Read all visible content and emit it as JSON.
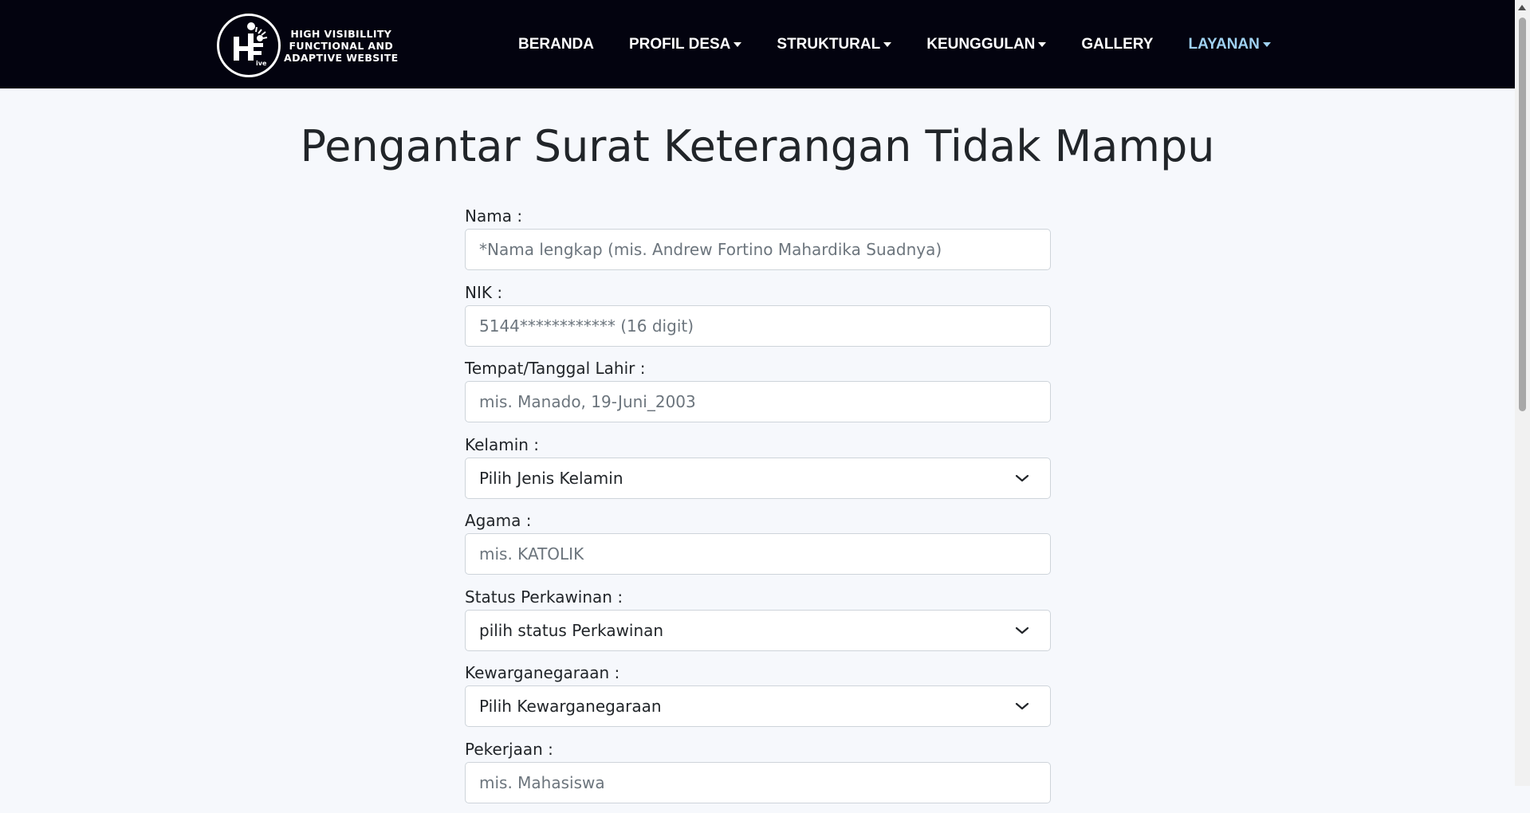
{
  "brand": {
    "logo_lines": [
      "HIGH VISIBILLITY",
      "FUNCTIONAL AND",
      "ADAPTIVE WEBSITE"
    ],
    "logo_mark": "H i F ive"
  },
  "nav": {
    "items": [
      {
        "label": "BERANDA",
        "has_dropdown": false,
        "active": false
      },
      {
        "label": "PROFIL DESA",
        "has_dropdown": true,
        "active": false
      },
      {
        "label": "STRUKTURAL",
        "has_dropdown": true,
        "active": false
      },
      {
        "label": "KEUNGGULAN",
        "has_dropdown": true,
        "active": false
      },
      {
        "label": "GALLERY",
        "has_dropdown": false,
        "active": false
      },
      {
        "label": "LAYANAN",
        "has_dropdown": true,
        "active": true
      }
    ]
  },
  "page": {
    "title": "Pengantar Surat Keterangan Tidak Mampu"
  },
  "form": {
    "fields": [
      {
        "label": "Nama :",
        "type": "input",
        "placeholder": "*Nama lengkap (mis. Andrew Fortino Mahardika Suadnya)",
        "value": ""
      },
      {
        "label": "NIK :",
        "type": "input",
        "placeholder": "5144************ (16 digit)",
        "value": ""
      },
      {
        "label": "Tempat/Tanggal Lahir :",
        "type": "input",
        "placeholder": "mis. Manado, 19-Juni_2003",
        "value": ""
      },
      {
        "label": "Kelamin :",
        "type": "select",
        "selected": "Pilih Jenis Kelamin"
      },
      {
        "label": "Agama :",
        "type": "input",
        "placeholder": "mis. KATOLIK",
        "value": ""
      },
      {
        "label": "Status Perkawinan :",
        "type": "select",
        "selected": "pilih status Perkawinan"
      },
      {
        "label": "Kewarganegaraan :",
        "type": "select",
        "selected": "Pilih Kewarganegaraan"
      },
      {
        "label": "Pekerjaan :",
        "type": "input",
        "placeholder": "mis. Mahasiswa",
        "value": ""
      }
    ]
  },
  "colors": {
    "navbar_bg": "#03030f",
    "page_bg": "#f6f8fc",
    "active_nav": "#9fd1f0",
    "text": "#212529",
    "placeholder": "#6c757d"
  },
  "icons": {
    "dropdown": "caret-down-icon",
    "select": "chevron-down-icon",
    "logo": "hifive-logo-icon"
  }
}
